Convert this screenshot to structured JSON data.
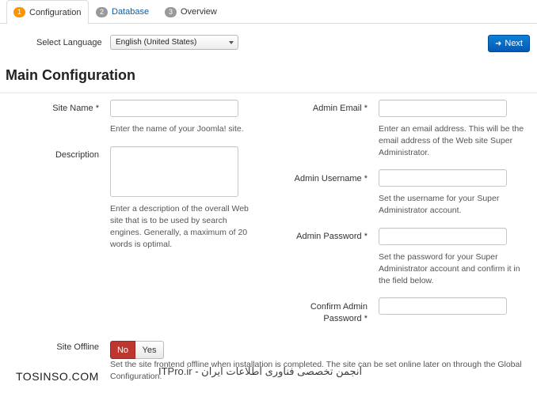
{
  "tabs": [
    {
      "number": "1",
      "label": "Configuration"
    },
    {
      "number": "2",
      "label": "Database"
    },
    {
      "number": "3",
      "label": "Overview"
    }
  ],
  "language": {
    "label": "Select Language",
    "selected": "English (United States)"
  },
  "next_button": {
    "label": "Next",
    "icon": "arrow-right-icon"
  },
  "section_title": "Main Configuration",
  "fields": {
    "site_name": {
      "label": "Site Name *",
      "value": "",
      "help": "Enter the name of your Joomla! site."
    },
    "description": {
      "label": "Description",
      "value": "",
      "help": "Enter a description of the overall Web site that is to be used by search engines. Generally, a maximum of 20 words is optimal."
    },
    "admin_email": {
      "label": "Admin Email *",
      "value": "",
      "help": "Enter an email address. This will be the email address of the Web site Super Administrator."
    },
    "admin_username": {
      "label": "Admin Username *",
      "value": "",
      "help": "Set the username for your Super Administrator account."
    },
    "admin_password": {
      "label": "Admin Password *",
      "value": "",
      "help": "Set the password for your Super Administrator account and confirm it in the field below."
    },
    "confirm_password": {
      "label_line1": "Confirm Admin",
      "label_line2": "Password *",
      "value": ""
    }
  },
  "site_offline": {
    "label": "Site Offline",
    "no_label": "No",
    "yes_label": "Yes",
    "selected": "No",
    "help": "Set the site frontend offline when installation is completed. The site can be set online later on through the Global Configuration."
  },
  "watermarks": {
    "left": "TOSINSO.COM",
    "right": "انجمن تخصصی فناوری اطلاعات ایران - ITPro.ir"
  },
  "colors": {
    "active_badge": "#f89406",
    "inactive_badge": "#999999",
    "link": "#0a5ea8",
    "primary_button": "#0a6fc7",
    "no_toggle": "#bd362f"
  }
}
